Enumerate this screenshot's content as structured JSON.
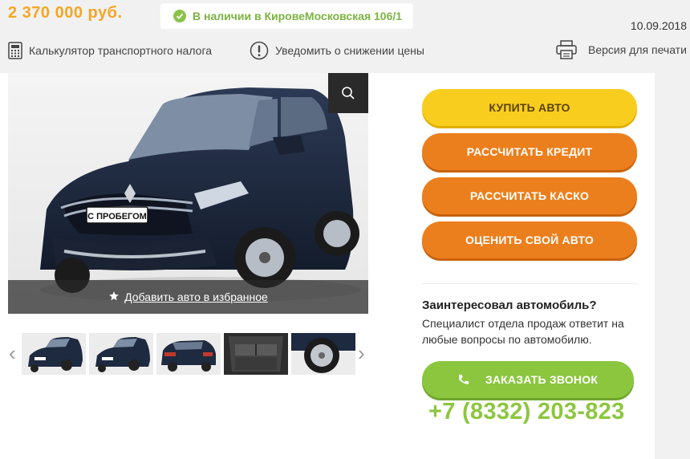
{
  "header": {
    "price": "2 370 000 руб.",
    "stock": "В наличии в КировеМосковская 106/1",
    "date": "10.09.2018"
  },
  "tools": {
    "tax_calc": "Калькулятор транспортного налога",
    "price_notify": "Уведомить о снижении цены",
    "print_version": "Версия для печати"
  },
  "photo": {
    "badge": "С ПРОБЕГОМ",
    "favorite": "Добавить авто в избранное",
    "thumbnails": [
      "front-3-4",
      "front-3-4",
      "rear-3-4",
      "trunk",
      "wheel"
    ]
  },
  "actions": {
    "buy": "КУПИТЬ АВТО",
    "credit": "РАССЧИТАТЬ КРЕДИТ",
    "kasko": "РАССЧИТАТЬ КАСКО",
    "trade_in": "ОЦЕНИТЬ СВОЙ АВТО"
  },
  "contact": {
    "title": "Заинтересовал автомобиль?",
    "text": "Специалист отдела продаж ответит на любые вопросы по автомобилю.",
    "call_button": "ЗАКАЗАТЬ ЗВОНОК",
    "phone": "+7 (8332) 203-823"
  },
  "colors": {
    "price": "#f5a623",
    "stock": "#7cb342",
    "buy_button": "#f9cd1d",
    "orange_button": "#ec7f1d",
    "green_button": "#8cc63f"
  }
}
